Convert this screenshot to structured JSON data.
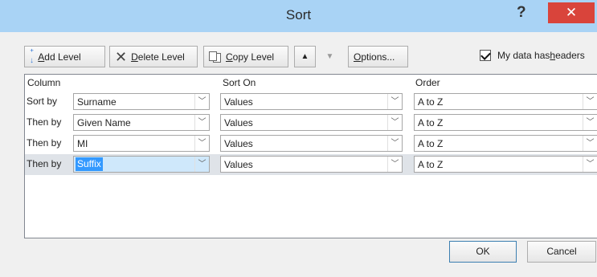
{
  "window": {
    "title": "Sort",
    "help_label": "?",
    "close_label": "✕"
  },
  "toolbar": {
    "add_level": {
      "prefix": "",
      "mnemonic": "A",
      "rest": "dd Level"
    },
    "delete_level": {
      "mnemonic": "D",
      "rest": "elete Level"
    },
    "copy_level": {
      "mnemonic": "C",
      "rest": "opy Level"
    },
    "move_up_label": "▲",
    "move_down_label": "▼",
    "options": {
      "mnemonic": "O",
      "rest": "ptions..."
    },
    "headers_checkbox": {
      "checked": true,
      "prefix": "My data has ",
      "mnemonic": "h",
      "rest": "eaders"
    }
  },
  "grid": {
    "headers": {
      "column": "Column",
      "sort_on": "Sort On",
      "order": "Order"
    },
    "rows": [
      {
        "label": "Sort by",
        "column": "Surname",
        "sort_on": "Values",
        "order": "A to Z"
      },
      {
        "label": "Then by",
        "column": "Given Name",
        "sort_on": "Values",
        "order": "A to Z"
      },
      {
        "label": "Then by",
        "column": "MI",
        "sort_on": "Values",
        "order": "A to Z"
      },
      {
        "label": "Then by",
        "column": "Suffix",
        "sort_on": "Values",
        "order": "A to Z"
      }
    ],
    "selected_row": 3
  },
  "buttons": {
    "ok": "OK",
    "cancel": "Cancel"
  },
  "icons": {
    "add": "add-level-icon",
    "delete": "delete-x-icon",
    "copy": "copy-pages-icon",
    "dropdown": "chevron-down-icon"
  },
  "colors": {
    "titlebar": "#a9d3f5",
    "close": "#d9443b",
    "selection": "#3399ff"
  }
}
